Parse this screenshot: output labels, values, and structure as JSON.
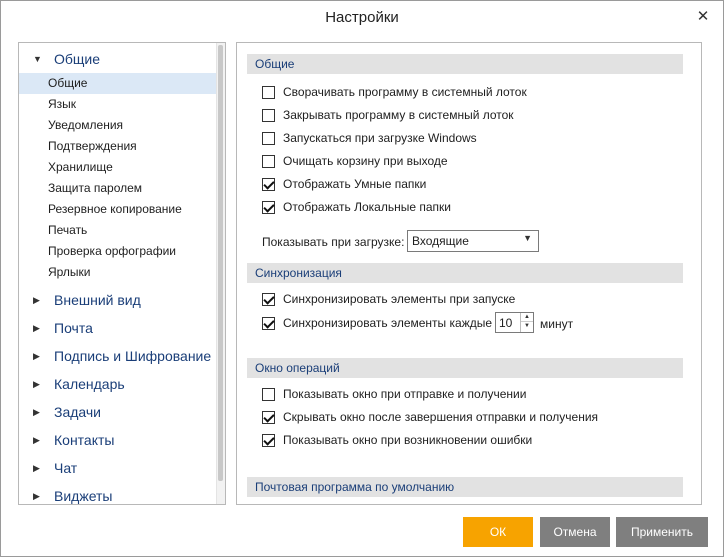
{
  "window": {
    "title": "Настройки",
    "close_glyph": "✕"
  },
  "sidebar": {
    "expanded_category": {
      "label": "Общие",
      "arrow": "▼"
    },
    "items": [
      "Общие",
      "Язык",
      "Уведомления",
      "Подтверждения",
      "Хранилище",
      "Защита паролем",
      "Резервное копирование",
      "Печать",
      "Проверка орфографии",
      "Ярлыки"
    ],
    "selected_item": "Общие",
    "collapsed_arrow": "▶",
    "categories": [
      "Внешний вид",
      "Почта",
      "Подпись и Шифрование",
      "Календарь",
      "Задачи",
      "Контакты",
      "Чат",
      "Виджеты"
    ]
  },
  "content": {
    "general": {
      "header": "Общие",
      "options": [
        {
          "label": "Сворачивать программу в системный лоток",
          "checked": false
        },
        {
          "label": "Закрывать программу в системный лоток",
          "checked": false
        },
        {
          "label": "Запускаться при загрузке Windows",
          "checked": false
        },
        {
          "label": "Очищать корзину при выходе",
          "checked": false
        },
        {
          "label": "Отображать Умные папки",
          "checked": true
        },
        {
          "label": "Отображать Локальные папки",
          "checked": true
        }
      ],
      "startup_label": "Показывать при загрузке:",
      "startup_value": "Входящие",
      "dropdown_arrow": "▼"
    },
    "sync": {
      "header": "Синхронизация",
      "option1": {
        "label": "Синхронизировать элементы при запуске",
        "checked": true
      },
      "option2": {
        "label": "Синхронизировать элементы каждые",
        "checked": true
      },
      "interval_value": "10",
      "interval_unit": "минут",
      "spin_up": "▲",
      "spin_down": "▼"
    },
    "ops": {
      "header": "Окно операций",
      "options": [
        {
          "label": "Показывать окно при отправке и получении",
          "checked": false
        },
        {
          "label": "Скрывать окно после завершения отправки и получения",
          "checked": true
        },
        {
          "label": "Показывать окно при возникновении ошибки",
          "checked": true
        }
      ]
    },
    "default_mail": {
      "header": "Почтовая программа по умолчанию"
    }
  },
  "buttons": {
    "ok": "ОК",
    "cancel": "Отмена",
    "apply": "Применить"
  },
  "colors": {
    "ok_button": "#f7a300",
    "secondary_button": "#7f7f7f",
    "section_header_bg": "#e2e2e2",
    "selected_item_bg": "#dbe8f6",
    "link_text": "#1a3e78"
  }
}
